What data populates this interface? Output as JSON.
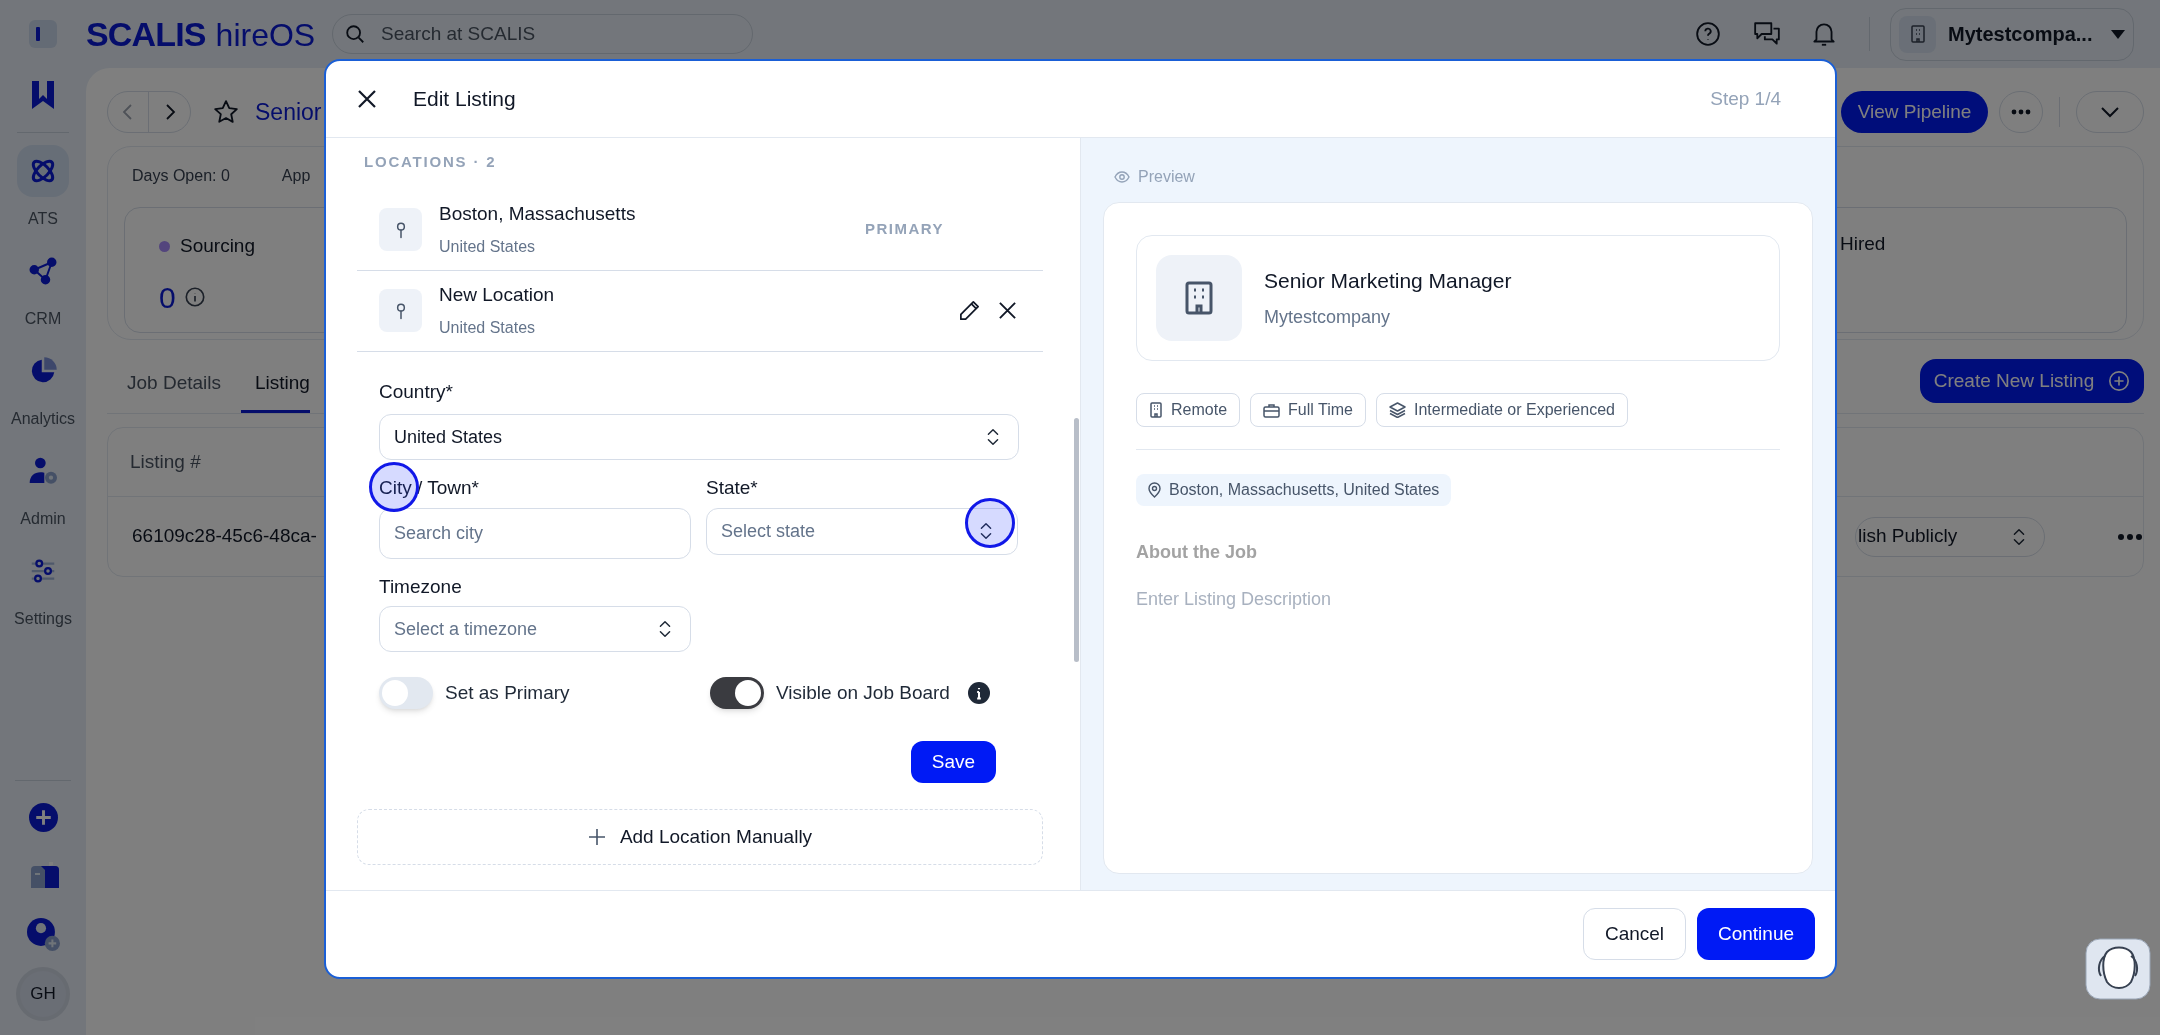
{
  "app_bar": {
    "logo": "SCALIS",
    "product": "hireOS",
    "search": {
      "placeholder": "Search at SCALIS"
    },
    "company": "Mytestcompa..."
  },
  "sidebar": {
    "items": [
      {
        "label": "ATS",
        "selected": true
      },
      {
        "label": "CRM",
        "selected": false
      },
      {
        "label": "Analytics",
        "selected": false
      },
      {
        "label": "Admin",
        "selected": false
      },
      {
        "label": "Settings",
        "selected": false
      }
    ],
    "avatar": "GH"
  },
  "page": {
    "title": "Senior",
    "stats": [
      "Days Open: 0",
      "App"
    ],
    "stages": [
      {
        "name": "Sourcing",
        "count": "0"
      },
      {
        "name": "Hired"
      }
    ],
    "view_pipeline": "View Pipeline",
    "create_listing": "Create New Listing",
    "tabs": [
      {
        "label": "Job Details",
        "selected": false
      },
      {
        "label": "Listing",
        "selected": true
      }
    ],
    "table": {
      "columns": [
        "Listing #"
      ],
      "rows": [
        {
          "id": "66109c28-45c6-48ca-",
          "status": "lish Publicly"
        }
      ]
    }
  },
  "modal": {
    "title": "Edit Listing",
    "step": "Step 1/4",
    "locations_heading": "LOCATIONS · 2",
    "locations": [
      {
        "name": "Boston, Massachusetts",
        "country": "United States",
        "primary": true,
        "badge": "PRIMARY"
      },
      {
        "name": "New Location",
        "country": "United States",
        "primary": false
      }
    ],
    "form": {
      "country": {
        "label": "Country*",
        "value": "United States"
      },
      "city": {
        "label": "City / Town*",
        "placeholder": "Search city"
      },
      "state": {
        "label": "State*",
        "placeholder": "Select state"
      },
      "timezone": {
        "label": "Timezone",
        "placeholder": "Select a timezone"
      },
      "toggles": [
        {
          "label": "Set as Primary",
          "on": false,
          "info": false
        },
        {
          "label": "Visible on Job Board",
          "on": true,
          "info": true
        }
      ],
      "save": "Save"
    },
    "add_location": "Add Location Manually",
    "preview": {
      "label": "Preview",
      "title": "Senior Marketing Manager",
      "company": "Mytestcompany",
      "tags": [
        "Remote",
        "Full Time",
        "Intermediate or Experienced"
      ],
      "location": "Boston, Massachusetts, United States",
      "about_heading": "About the Job",
      "description_placeholder": "Enter Listing Description"
    },
    "buttons": {
      "cancel": "Cancel",
      "continue": "Continue"
    }
  }
}
